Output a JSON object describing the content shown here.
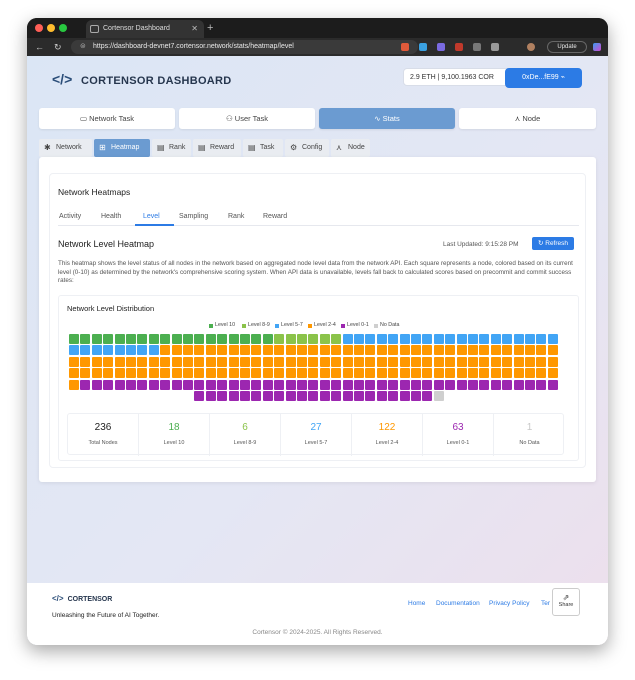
{
  "browser": {
    "tab_title": "Cortensor Dashboard",
    "url": "https://dashboard-devnet7.cortensor.network/stats/heatmap/level",
    "update_label": "Update"
  },
  "header": {
    "logo_text": "CORTENSOR DASHBOARD",
    "balance": "2.9 ETH | 9,100.1963 COR",
    "address": "0xDe...fE99"
  },
  "main_tabs": [
    {
      "label": "Network Task",
      "icon": "monitor-icon"
    },
    {
      "label": "User Task",
      "icon": "user-icon"
    },
    {
      "label": "Stats",
      "icon": "activity-icon"
    },
    {
      "label": "Node",
      "icon": "network-icon"
    }
  ],
  "sub_tabs": [
    {
      "label": "Network",
      "icon": "hub-icon"
    },
    {
      "label": "Heatmap",
      "icon": "grid-icon"
    },
    {
      "label": "Rank",
      "icon": "doc-icon"
    },
    {
      "label": "Reward",
      "icon": "doc-icon"
    },
    {
      "label": "Task",
      "icon": "doc-icon"
    },
    {
      "label": "Config",
      "icon": "gear-icon"
    },
    {
      "label": "Node",
      "icon": "network-icon"
    }
  ],
  "card": {
    "title": "Network Heatmaps",
    "tabs": [
      "Activity",
      "Health",
      "Level",
      "Sampling",
      "Rank",
      "Reward"
    ],
    "active_tab": "Level"
  },
  "level": {
    "title": "Network Level Heatmap",
    "last_updated": "Last Updated: 9:15:28 PM",
    "refresh_label": "Refresh",
    "description": "This heatmap shows the level status of all nodes in the network based on aggregated node level data from the network API. Each square represents a node, colored based on its current level (0-10) as determined by the network's comprehensive scoring system. When API data is unavailable, levels fall back to calculated scores based on precommit and commit success rates:"
  },
  "distribution": {
    "title": "Network Level Distribution",
    "legend": [
      {
        "label": "Level 10",
        "color": "#4caf50"
      },
      {
        "label": "Level 8-9",
        "color": "#8bc34a"
      },
      {
        "label": "Level 5-7",
        "color": "#42a5f5"
      },
      {
        "label": "Level 2-4",
        "color": "#ff9800"
      },
      {
        "label": "Level 0-1",
        "color": "#9c27b0"
      },
      {
        "label": "No Data",
        "color": "#cfcfcf"
      }
    ],
    "node_counts": {
      "level10": 18,
      "level89": 6,
      "level57": 27,
      "level24": 122,
      "level01": 63,
      "nodata": 1
    },
    "stats": [
      {
        "value": "236",
        "label": "Total Nodes",
        "color": "#222222"
      },
      {
        "value": "18",
        "label": "Level 10",
        "color": "#4caf50"
      },
      {
        "value": "6",
        "label": "Level 8-9",
        "color": "#8bc34a"
      },
      {
        "value": "27",
        "label": "Level 5-7",
        "color": "#42a5f5"
      },
      {
        "value": "122",
        "label": "Level 2-4",
        "color": "#ff9800"
      },
      {
        "value": "63",
        "label": "Level 0-1",
        "color": "#9c27b0"
      },
      {
        "value": "1",
        "label": "No Data",
        "color": "#c8c8c8"
      }
    ]
  },
  "footer": {
    "logo": "CORTENSOR",
    "tagline": "Unleashing the Future of AI Together.",
    "links": [
      "Home",
      "Documentation",
      "Privacy Policy",
      "Ter"
    ],
    "share_label": "Share",
    "copyright": "Cortensor © 2024-2025. All Rights Reserved."
  }
}
